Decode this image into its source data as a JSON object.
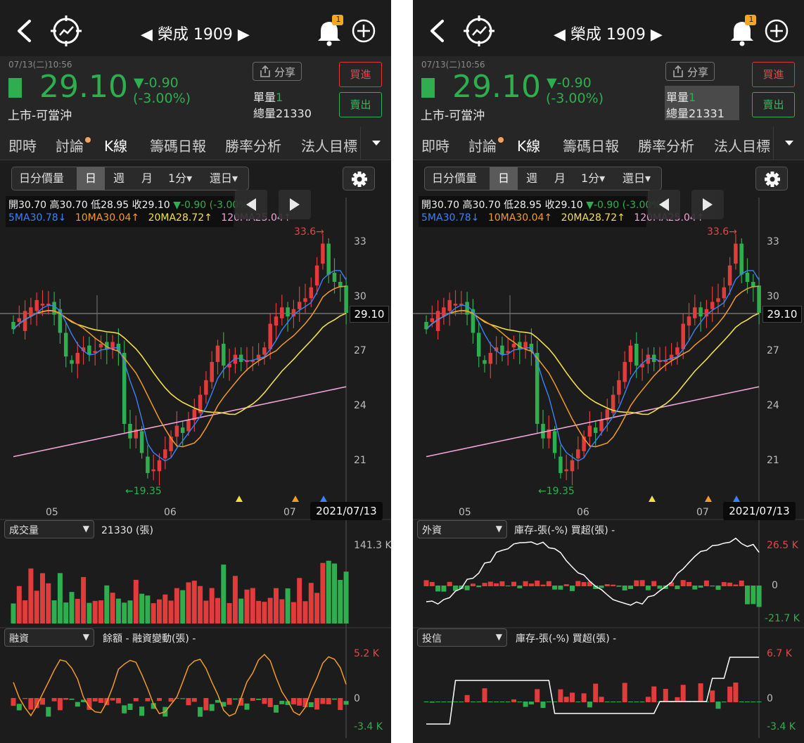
{
  "left": {
    "nav": {
      "title": "◀ 榮成 1909 ▶",
      "badge": "1"
    },
    "quote": {
      "datetime": "07/13(二)10:56",
      "price": "29.10",
      "change": "▼-0.90",
      "change_pct": "(-3.00%)",
      "market": "上市-可當沖",
      "share_label": "分享",
      "unit_vol_label": "單量",
      "unit_vol": "1",
      "total_vol_label": "總量",
      "total_vol": "21330",
      "buy": "買進",
      "sell": "賣出"
    },
    "tabs": [
      "即時",
      "討論",
      "K線",
      "籌碼日報",
      "勝率分析",
      "法人目標"
    ],
    "segments": [
      "日分價量",
      "日",
      "週",
      "月",
      "1分▾",
      "還日▾"
    ],
    "ohlc": {
      "open": "開30.70",
      "high": "高30.70",
      "low": "低28.95",
      "close": "收29.10",
      "chg": "▼-0.90",
      "chg_pct": "(-3.00%)"
    },
    "ma": {
      "ma5": "5MA30.78↓",
      "ma10": "10MA30.04↑",
      "ma20": "20MA28.72↑",
      "ma120": "120MA25.04↑"
    },
    "y_ticks": [
      "33",
      "30",
      "27",
      "24",
      "21"
    ],
    "price_tag": "29.10",
    "high_tag": "33.6→",
    "low_tag": "←19.35",
    "x_ticks": [
      "05",
      "06",
      "07"
    ],
    "date_tag": "2021/07/13",
    "sub1": {
      "select": "成交量",
      "info": "21330 (張)",
      "top": "141.3 K",
      "mid": "",
      "bot": ""
    },
    "sub2": {
      "select": "融資",
      "info": "餘額 -   融資變動(張) -",
      "top": "5.2 K",
      "mid": "0",
      "bot": "-3.4 K"
    }
  },
  "right": {
    "nav": {
      "title": "◀ 榮成 1909 ▶",
      "badge": "1"
    },
    "quote": {
      "datetime": "07/13(二)10:56",
      "price": "29.10",
      "change": "▼-0.90",
      "change_pct": "(-3.00%)",
      "market": "上市-可當沖",
      "share_label": "分享",
      "unit_vol_label": "單量",
      "unit_vol": "1",
      "total_vol_label": "總量",
      "total_vol": "21331",
      "buy": "買進",
      "sell": "賣出"
    },
    "tabs": [
      "即時",
      "討論",
      "K線",
      "籌碼日報",
      "勝率分析",
      "法人目標"
    ],
    "segments": [
      "日分價量",
      "日",
      "週",
      "月",
      "1分▾",
      "還日▾"
    ],
    "ohlc": {
      "open": "開30.70",
      "high": "高30.70",
      "low": "低28.95",
      "close": "收29.10",
      "chg": "▼-0.90",
      "chg_pct": "(-3.00%)"
    },
    "ma": {
      "ma5": "5MA30.78↓",
      "ma10": "10MA30.04↑",
      "ma20": "20MA28.72↑",
      "ma120": "120MA25.04↑"
    },
    "y_ticks": [
      "33",
      "30",
      "27",
      "24",
      "21"
    ],
    "price_tag": "29.10",
    "high_tag": "33.6→",
    "low_tag": "←19.35",
    "x_ticks": [
      "05",
      "06",
      "07"
    ],
    "date_tag": "2021/07/13",
    "sub1": {
      "select": "外資",
      "info": "庫存-張(-%)  買超(張) -",
      "top": "26.5 K",
      "mid": "0",
      "bot": "-21.7 K"
    },
    "sub2": {
      "select": "投信",
      "info": "庫存-張(-%)  買超(張) -",
      "top": "6.7 K",
      "mid": "0",
      "bot": "-3.4 K"
    }
  },
  "colors": {
    "up": "#e23b3b",
    "down": "#2fae4f",
    "ma5": "#3b82f6",
    "ma10": "#f29b2a",
    "ma20": "#f0e04a",
    "ma120": "#f0a5d6",
    "bg": "#1c1c1c"
  },
  "chart_data": {
    "type": "candlestick",
    "x": [
      "05",
      "06",
      "07"
    ],
    "ylim": [
      19,
      34
    ],
    "y_ticks": [
      21,
      24,
      27,
      30,
      33
    ],
    "last_close": 29.1,
    "high": 33.6,
    "low": 19.35,
    "ohlc_first": [
      28.6,
      28.6,
      28.1,
      28.9,
      29.2,
      29.5,
      29.6,
      29.7,
      29.3,
      28.0,
      26.5,
      26.3,
      27.0,
      27.3,
      26.9,
      27.2,
      27.5,
      27.1,
      27.4,
      26.9,
      23.0,
      22.2,
      22.6,
      21.2,
      20.4,
      20.4,
      21.1,
      21.5,
      22.3,
      22.8,
      22.6,
      23.2,
      23.6,
      24.6,
      25.3,
      26.4,
      27.4,
      26.1,
      26.3,
      26.8,
      26.4,
      26.4,
      26.5,
      26.8,
      27.1,
      28.4,
      28.8,
      29.4,
      28.9,
      29.3,
      29.7,
      29.9,
      30.6,
      31.8,
      32.9,
      31.3,
      30.8,
      30.6
    ],
    "ohlc_last": [
      28.2,
      28.8,
      29.2,
      29.4,
      29.8,
      29.6,
      29.6,
      29.0,
      28.0,
      26.7,
      26.3,
      26.9,
      27.2,
      26.8,
      27.0,
      27.4,
      27.1,
      27.5,
      27.0,
      23.0,
      22.2,
      22.7,
      21.4,
      20.3,
      20.5,
      21.0,
      21.6,
      22.3,
      22.9,
      22.5,
      23.2,
      23.8,
      24.6,
      25.4,
      26.4,
      27.3,
      26.2,
      26.3,
      26.8,
      26.4,
      26.5,
      26.5,
      26.8,
      27.2,
      28.5,
      28.9,
      29.4,
      28.9,
      29.3,
      29.7,
      29.9,
      30.5,
      31.7,
      32.9,
      31.2,
      30.8,
      30.5,
      29.1
    ],
    "ma120_start": 21.2,
    "ma120_end": 25.04
  }
}
